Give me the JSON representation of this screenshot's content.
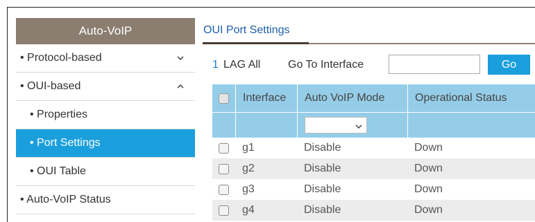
{
  "sidebar": {
    "header": "Auto-VoIP",
    "items": [
      {
        "label": "• Protocol-based",
        "icon": "chevron-down-icon"
      },
      {
        "label": "• OUI-based",
        "icon": "chevron-up-icon"
      },
      {
        "label": "• Properties"
      },
      {
        "label": "• Port Settings",
        "active": true
      },
      {
        "label": "• OUI Table"
      },
      {
        "label": "• Auto-VoIP Status"
      }
    ]
  },
  "main": {
    "title": "OUI Port Settings",
    "toolbar": {
      "link_1": "1",
      "lag_all": "LAG All",
      "goto_label": "Go To Interface",
      "goto_value": "",
      "go_button": "Go"
    },
    "table": {
      "headers": [
        "Interface",
        "Auto VoIP Mode",
        "Operational Status"
      ],
      "filter_select_value": "",
      "rows": [
        {
          "interface": "g1",
          "mode": "Disable",
          "status": "Down"
        },
        {
          "interface": "g2",
          "mode": "Disable",
          "status": "Down"
        },
        {
          "interface": "g3",
          "mode": "Disable",
          "status": "Down"
        },
        {
          "interface": "g4",
          "mode": "Disable",
          "status": "Down"
        }
      ]
    }
  },
  "colors": {
    "accent": "#1a9fdc",
    "sidebar_header": "#8b7d70",
    "table_header": "#95cde8",
    "title_text": "#1c5fa8"
  }
}
